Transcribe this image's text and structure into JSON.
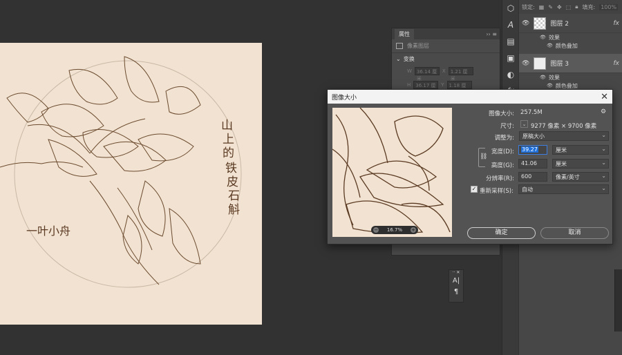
{
  "properties_panel": {
    "tab_label": "属性",
    "layer_type": "像素图层",
    "transform_section": "变换",
    "w_label": "W",
    "w_value": "36.14 厘米",
    "x_label": "X",
    "x_value": "1.21 厘米",
    "h_label": "H",
    "h_value": "36.17 厘米",
    "y_label": "Y",
    "y_value": "1.18 厘米"
  },
  "layers_panel": {
    "lock_label": "锁定:",
    "fill_label": "填充:",
    "fill_value": "100%",
    "layers": [
      {
        "name": "图层 2",
        "effects_label": "效果",
        "effect": "颜色叠加",
        "fx": "fx"
      },
      {
        "name": "图层 3",
        "effects_label": "效果",
        "effect": "颜色叠加",
        "fx": "fx"
      }
    ]
  },
  "mini_panel": {
    "type_tool": "A|",
    "paragraph": "¶"
  },
  "dialog": {
    "title": "图像大小",
    "image_size_label": "图像大小:",
    "image_size_value": "257.5M",
    "dimensions_label": "尺寸:",
    "dimensions_value": "9277 像素  ×  9700 像素",
    "fit_label": "调整为:",
    "fit_value": "原稿大小",
    "width_label": "宽度(D):",
    "width_value": "39.27",
    "width_unit": "厘米",
    "height_label": "高度(G):",
    "height_value": "41.06",
    "height_unit": "厘米",
    "resolution_label": "分辨率(R):",
    "resolution_value": "600",
    "resolution_unit": "像素/英寸",
    "resample_label": "重新采样(S):",
    "resample_value": "自动",
    "zoom_value": "16.7%",
    "ok_label": "确定",
    "cancel_label": "取消"
  },
  "canvas": {
    "artwork_text": "山上的铁皮石斛",
    "signature_text": "一叶小舟"
  }
}
